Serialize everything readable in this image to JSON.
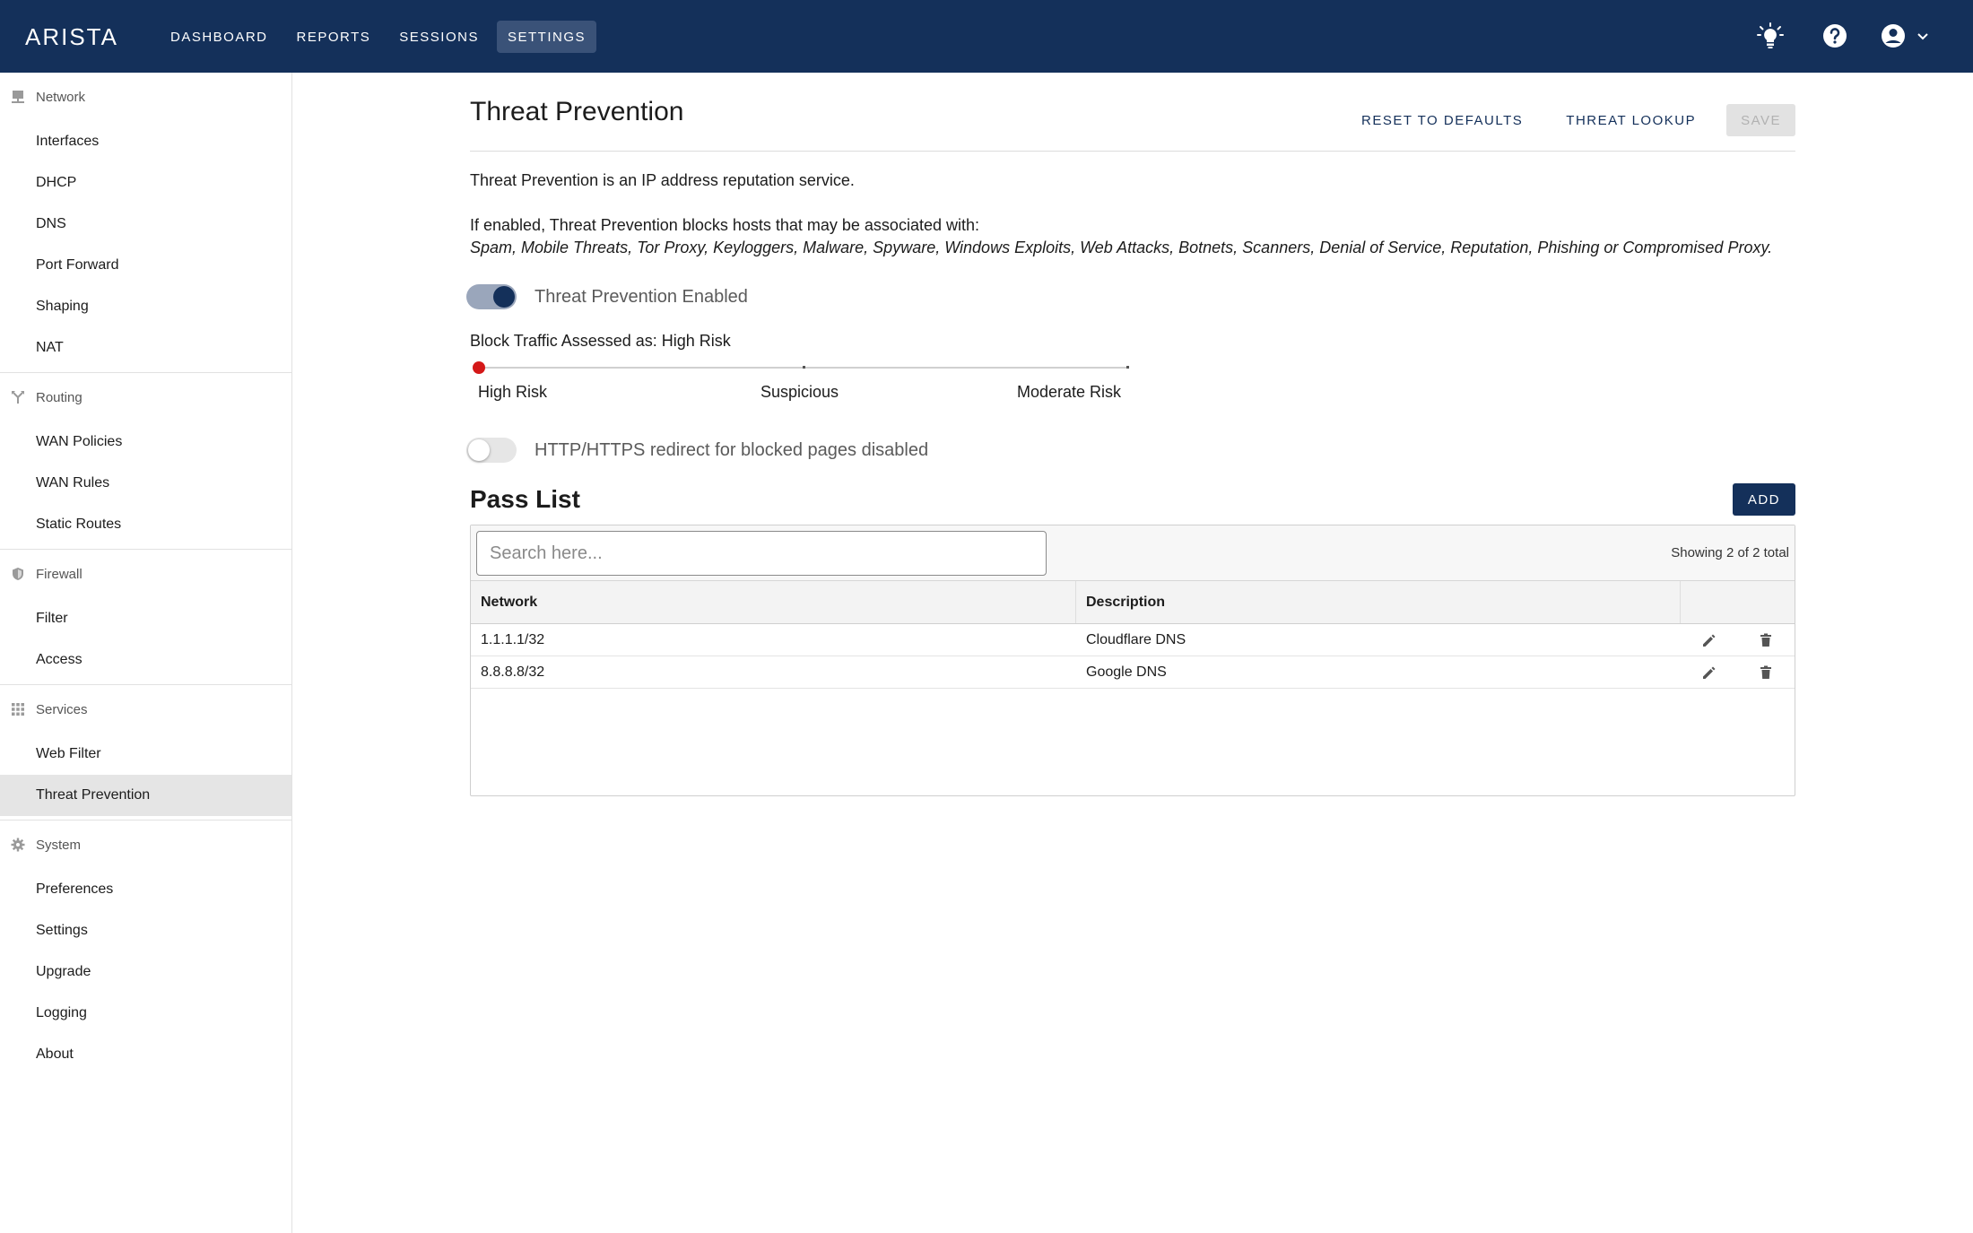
{
  "app": {
    "logo": "ARISTA"
  },
  "nav": [
    {
      "label": "DASHBOARD",
      "active": false
    },
    {
      "label": "REPORTS",
      "active": false
    },
    {
      "label": "SESSIONS",
      "active": false
    },
    {
      "label": "SETTINGS",
      "active": true
    }
  ],
  "top_icons": [
    "lightbulb-icon",
    "help-icon",
    "account-icon",
    "chevron-down-icon"
  ],
  "sidebar": {
    "sections": [
      {
        "label": "Network",
        "icon": "network-icon",
        "items": [
          "Interfaces",
          "DHCP",
          "DNS",
          "Port Forward",
          "Shaping",
          "NAT"
        ]
      },
      {
        "label": "Routing",
        "icon": "routing-icon",
        "items": [
          "WAN Policies",
          "WAN Rules",
          "Static Routes"
        ]
      },
      {
        "label": "Firewall",
        "icon": "shield-icon",
        "items": [
          "Filter",
          "Access"
        ]
      },
      {
        "label": "Services",
        "icon": "grid-icon",
        "items": [
          "Web Filter",
          "Threat Prevention"
        ]
      },
      {
        "label": "System",
        "icon": "gear-icon",
        "items": [
          "Preferences",
          "Settings",
          "Upgrade",
          "Logging",
          "About"
        ]
      }
    ],
    "active_item": "Threat Prevention"
  },
  "page": {
    "title": "Threat Prevention",
    "reset_label": "RESET TO DEFAULTS",
    "lookup_label": "THREAT LOOKUP",
    "save_label": "SAVE",
    "description": "Threat Prevention is an IP address reputation service.",
    "enabled_intro": "If enabled, Threat Prevention blocks hosts that may be associated with:",
    "threat_list": "Spam, Mobile Threats, Tor Proxy, Keyloggers, Malware, Spyware, Windows Exploits, Web Attacks, Botnets, Scanners, Denial of Service, Reputation, Phishing or Compromised Proxy.",
    "enabled_toggle": {
      "label": "Threat Prevention Enabled",
      "on": true
    },
    "block_label": "Block Traffic Assessed as: High Risk",
    "slider": {
      "labels": [
        "High Risk",
        "Suspicious",
        "Moderate Risk"
      ],
      "value_index": 0
    },
    "redirect_toggle": {
      "label": "HTTP/HTTPS redirect for blocked pages disabled",
      "on": false
    }
  },
  "pass_list": {
    "title": "Pass List",
    "add_label": "ADD",
    "search_placeholder": "Search here...",
    "count_text": "Showing 2 of 2 total",
    "columns": [
      "Network",
      "Description"
    ],
    "rows": [
      {
        "network": "1.1.1.1/32",
        "description": "Cloudflare DNS"
      },
      {
        "network": "8.8.8.8/32",
        "description": "Google DNS"
      }
    ]
  },
  "colors": {
    "brand": "#14305a",
    "nav_active": "#3a5278",
    "slider_thumb": "#d41818"
  }
}
